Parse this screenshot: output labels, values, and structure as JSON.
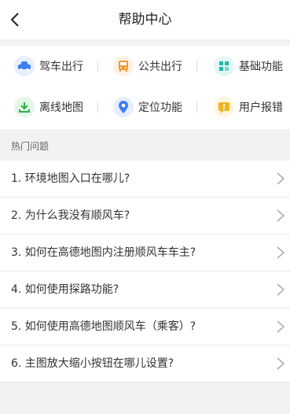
{
  "header": {
    "title": "帮助中心",
    "back_icon": "chevron-left-icon"
  },
  "tiles": [
    {
      "label": "驾车出行",
      "icon": "car-icon",
      "color": "#3d7ff0"
    },
    {
      "label": "公共出行",
      "icon": "bus-icon",
      "color": "#f09a35"
    },
    {
      "label": "基础功能",
      "icon": "grid-icon",
      "color": "#22b8a7"
    },
    {
      "label": "离线地图",
      "icon": "download-icon",
      "color": "#28b24a"
    },
    {
      "label": "定位功能",
      "icon": "location-pin-icon",
      "color": "#3d7ff0"
    },
    {
      "label": "用户报错",
      "icon": "alert-icon",
      "color": "#f3b320"
    }
  ],
  "section": {
    "title": "热门问题"
  },
  "faq": [
    {
      "label": "1. 环境地图入口在哪儿?"
    },
    {
      "label": "2. 为什么我没有顺风车?"
    },
    {
      "label": "3. 如何在高德地图内注册顺风车车主?"
    },
    {
      "label": "4. 如何使用探路功能?"
    },
    {
      "label": "5. 如何使用高德地图顺风车（乘客）?"
    },
    {
      "label": "6. 主图放大缩小按钮在哪儿设置?"
    }
  ]
}
